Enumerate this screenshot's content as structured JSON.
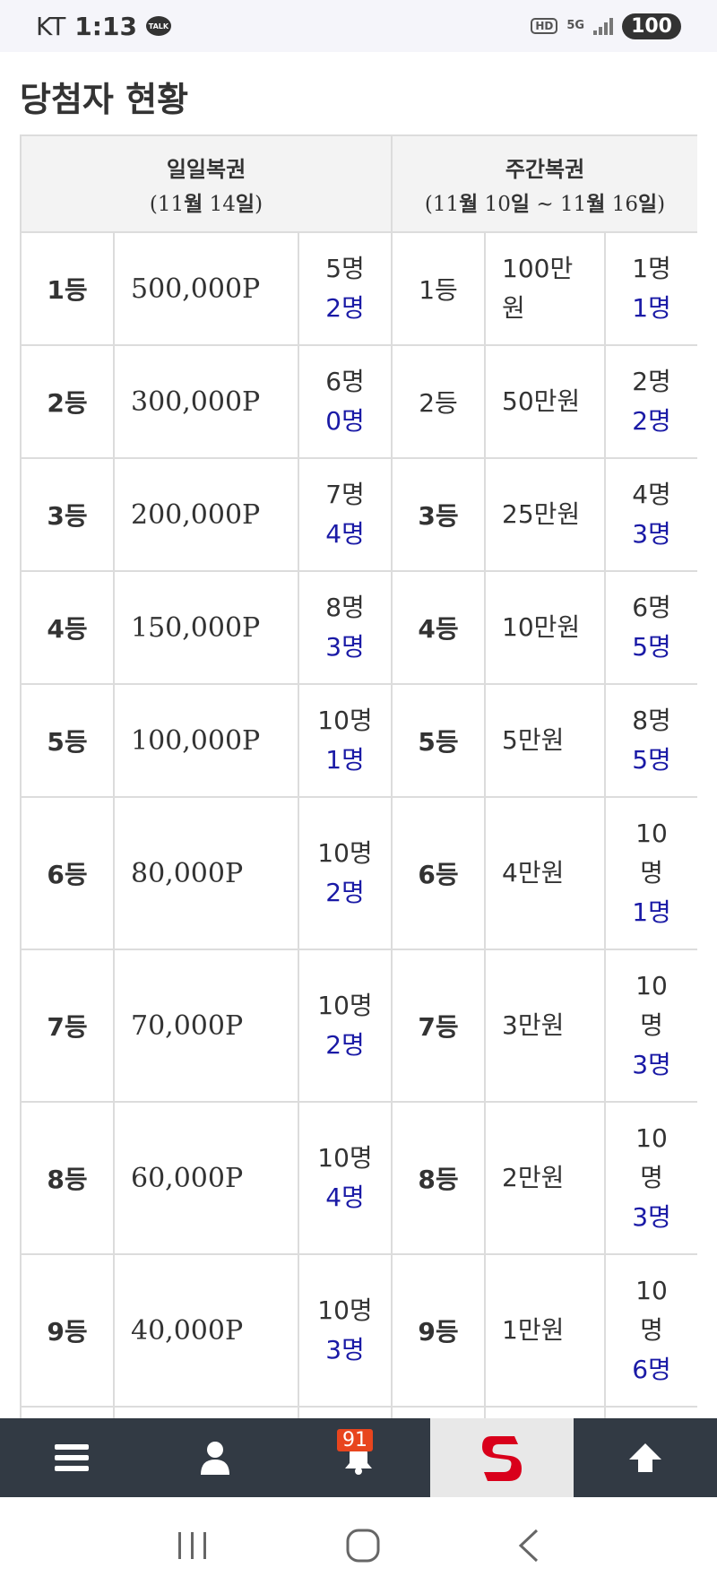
{
  "status_bar": {
    "carrier": "KT",
    "time": "1:13",
    "talk_label": "TALK",
    "hd_label": "HD",
    "network_label": "5G",
    "battery": "100"
  },
  "page": {
    "title": "당첨자 현황"
  },
  "table": {
    "daily_header": {
      "title": "일일복권",
      "date_prefix": "(11",
      "month": "월",
      "day_num": " 14",
      "day_unit": "일",
      "date_suffix": ")"
    },
    "weekly_header": {
      "title": "주간복권",
      "p1": "(11",
      "m1": "월",
      "p2": " 10",
      "d1": "일",
      "p3": " ~ 11",
      "m2": "월",
      "p4": " 16",
      "d2": "일",
      "p5": ")"
    },
    "rows": [
      {
        "d_rank": "1등",
        "d_prize": "500,000P",
        "d_total": "5명",
        "d_won": "2명",
        "w_rank": "1등",
        "w_prize": "100만원",
        "w_total": "1명",
        "w_won": "1명"
      },
      {
        "d_rank": "2등",
        "d_prize": "300,000P",
        "d_total": "6명",
        "d_won": "0명",
        "w_rank": "2등",
        "w_prize": "50만원",
        "w_total": "2명",
        "w_won": "2명"
      },
      {
        "d_rank": "3등",
        "d_prize": "200,000P",
        "d_total": "7명",
        "d_won": "4명",
        "w_rank": "3등",
        "w_prize": "25만원",
        "w_total": "4명",
        "w_won": "3명"
      },
      {
        "d_rank": "4등",
        "d_prize": "150,000P",
        "d_total": "8명",
        "d_won": "3명",
        "w_rank": "4등",
        "w_prize": "10만원",
        "w_total": "6명",
        "w_won": "5명"
      },
      {
        "d_rank": "5등",
        "d_prize": "100,000P",
        "d_total": "10명",
        "d_won": "1명",
        "w_rank": "5등",
        "w_prize": "5만원",
        "w_total": "8명",
        "w_won": "5명"
      },
      {
        "d_rank": "6등",
        "d_prize": "80,000P",
        "d_total": "10명",
        "d_won": "2명",
        "w_rank": "6등",
        "w_prize": "4만원",
        "w_total": "10명",
        "w_won": "1명"
      },
      {
        "d_rank": "7등",
        "d_prize": "70,000P",
        "d_total": "10명",
        "d_won": "2명",
        "w_rank": "7등",
        "w_prize": "3만원",
        "w_total": "10명",
        "w_won": "3명"
      },
      {
        "d_rank": "8등",
        "d_prize": "60,000P",
        "d_total": "10명",
        "d_won": "4명",
        "w_rank": "8등",
        "w_prize": "2만원",
        "w_total": "10명",
        "w_won": "3명"
      },
      {
        "d_rank": "9등",
        "d_prize": "40,000P",
        "d_total": "10명",
        "d_won": "3명",
        "w_rank": "9등",
        "w_prize": "1만원",
        "w_total": "10명",
        "w_won": "6명"
      }
    ]
  },
  "bottom_nav": {
    "notification_count": "91"
  },
  "colors": {
    "won_count": "#1a1aa6",
    "nav_bg": "#323a44",
    "badge": "#e8451e",
    "brand_red": "#d9001b"
  }
}
